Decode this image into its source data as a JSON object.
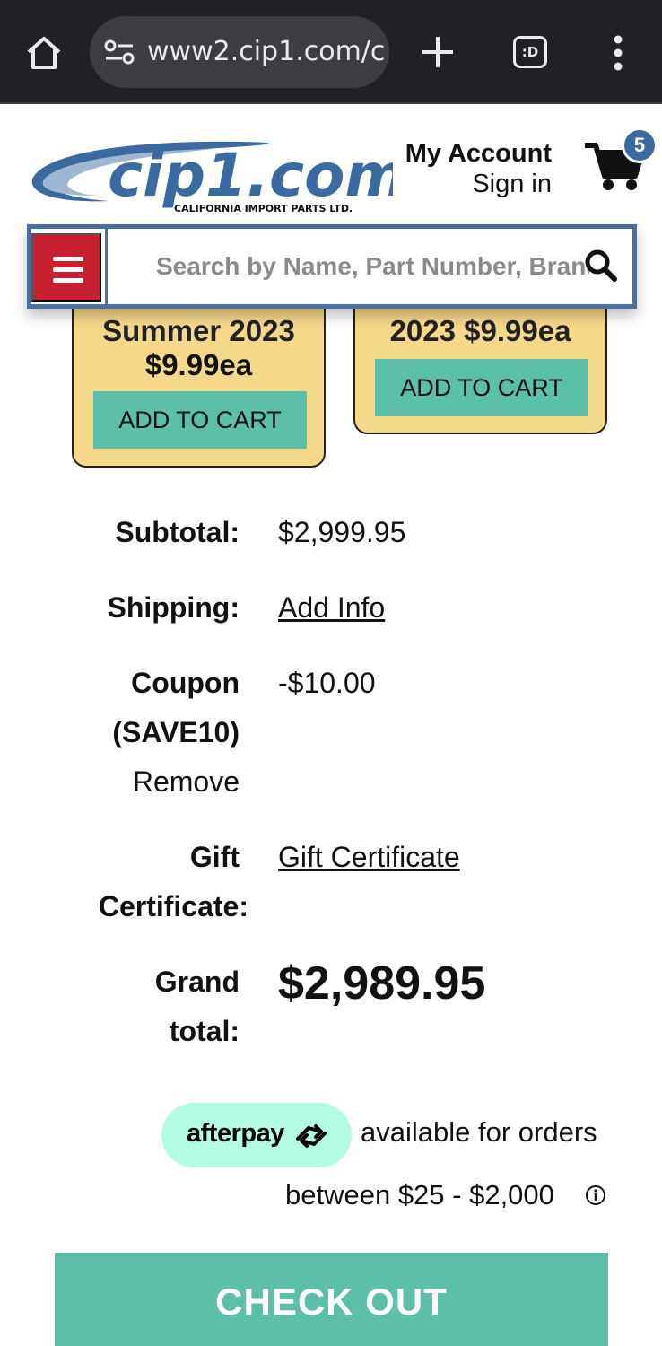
{
  "browser": {
    "url": "www2.cip1.com/c",
    "tab_count": ":D",
    "icons": [
      "home-icon",
      "site-settings-icon",
      "plus-icon",
      "tab-switcher-icon",
      "more-vert-icon"
    ]
  },
  "header": {
    "logo_text": "cip1.com",
    "logo_subtitle": "CALIFORNIA IMPORT PARTS LTD.",
    "account_title": "My Account",
    "account_signin": "Sign in",
    "cart_count": "5",
    "search_placeholder": "Search by Name, Part Number, Brand"
  },
  "promos": [
    {
      "line": "Summer 2023",
      "price": "$9.99ea",
      "button": "ADD TO CART"
    },
    {
      "line": "2023 $9.99ea",
      "button": "ADD TO CART"
    }
  ],
  "totals": {
    "subtotal_label": "Subtotal:",
    "subtotal_value": "$2,999.95",
    "shipping_label": "Shipping:",
    "shipping_link": "Add Info",
    "coupon_label_1": "Coupon",
    "coupon_label_2": "(SAVE10)",
    "coupon_remove": "Remove",
    "coupon_value": "-$10.00",
    "gift_label_1": "Gift",
    "gift_label_2": "Certificate:",
    "gift_link": "Gift Certificate",
    "grand_label_1": "Grand",
    "grand_label_2": "total:",
    "grand_value": "$2,989.95"
  },
  "afterpay": {
    "brand": "afterpay",
    "text_line1": "available for orders",
    "text_line2": "between $25 - $2,000"
  },
  "checkout": {
    "label": "CHECK OUT"
  },
  "colors": {
    "brand_blue": "#3b6aa0",
    "menu_red": "#c8202e",
    "teal": "#5cbfa9",
    "promo_yellow": "#f5d98b",
    "afterpay_mint": "#b2fce4"
  }
}
